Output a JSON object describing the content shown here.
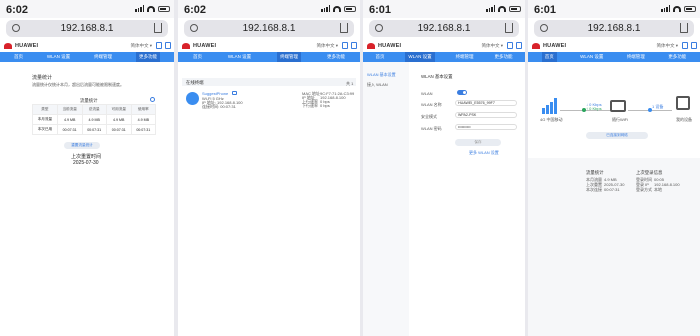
{
  "panels": [
    {
      "time": "6:02",
      "url": "192.168.8.1"
    },
    {
      "time": "6:02",
      "url": "192.168.8.1"
    },
    {
      "time": "6:01",
      "url": "192.168.8.1"
    },
    {
      "time": "6:01",
      "url": "192.168.8.1"
    }
  ],
  "brand": "HUAWEI",
  "nav": {
    "home": "首页",
    "wlan": "WLAN 设置",
    "devices": "终端管理",
    "more": "更多功能"
  },
  "panel1": {
    "title": "流量统计",
    "desc": "流量统计仅统计本月，超出后流量可能被限制速度。",
    "table_title": "流量统计",
    "headers": [
      "类型",
      "当前流量",
      "总流量",
      "可用流量",
      "使用率"
    ],
    "rows": [
      [
        "本月流量",
        "4.9 MB",
        "4.9 MB",
        "4.9 MB",
        "4.9 MB"
      ],
      [
        "本次已用",
        "00:07:31",
        "00:07:31",
        "00:07:31",
        "00:07:31"
      ]
    ],
    "button": "重置流量统计",
    "last_label": "上次重置时间",
    "last_date": "2025-07-30"
  },
  "panel2": {
    "title": "在线终端",
    "count": "共 1",
    "device_name": "SuggestPhone",
    "device_wifi": "Wi-Fi 5 GHz",
    "device_ip": "IP 地址: 192.168.8.100",
    "device_time": "连接时间: 00:07:31",
    "mac_label": "MAC 地址",
    "mac": "9C:F7:71:2A:C3:99",
    "ip_label": "IP 地址",
    "ip": "192.168.8.100",
    "up_label": "上行速率",
    "up": "0 bps",
    "down_label": "下行速率",
    "down": "0 bps"
  },
  "panel3": {
    "title": "WLAN 基本设置",
    "sub_title": "接入 WLAN",
    "toggle_label": "WLAN",
    "ssid_label": "WLAN 名称",
    "ssid": "HUAWEI_E5576_99F7",
    "sec_label": "安全模式",
    "sec": "WPA2-PSK",
    "pwd_label": "WLAN 密码",
    "pwd": "••••••••••",
    "save": "保存",
    "more": "更多 WLAN 设置"
  },
  "panel4": {
    "net": "4G 中国移动",
    "down_rate": "↓ 0 Kbps",
    "up_rate": "↑ 0 Kbps",
    "router": "随行WiFi",
    "dev_rate": "1 设备",
    "device": "我的设备",
    "btn": "已连接到网络",
    "s1_title": "流量统计",
    "s1_l1": "本月流量",
    "s1_v1": "4.9 MB",
    "s1_l2": "上次重置",
    "s1_v2": "2025-07-30",
    "s1_l3": "本次连接",
    "s1_v3": "00:07:31",
    "s2_title": "上次登录信息",
    "s2_l1": "登录时间",
    "s2_v1": "00:05",
    "s2_l2": "登录 IP",
    "s2_v2": "192.168.8.100",
    "s2_l3": "登录方式",
    "s2_v3": "本地"
  }
}
